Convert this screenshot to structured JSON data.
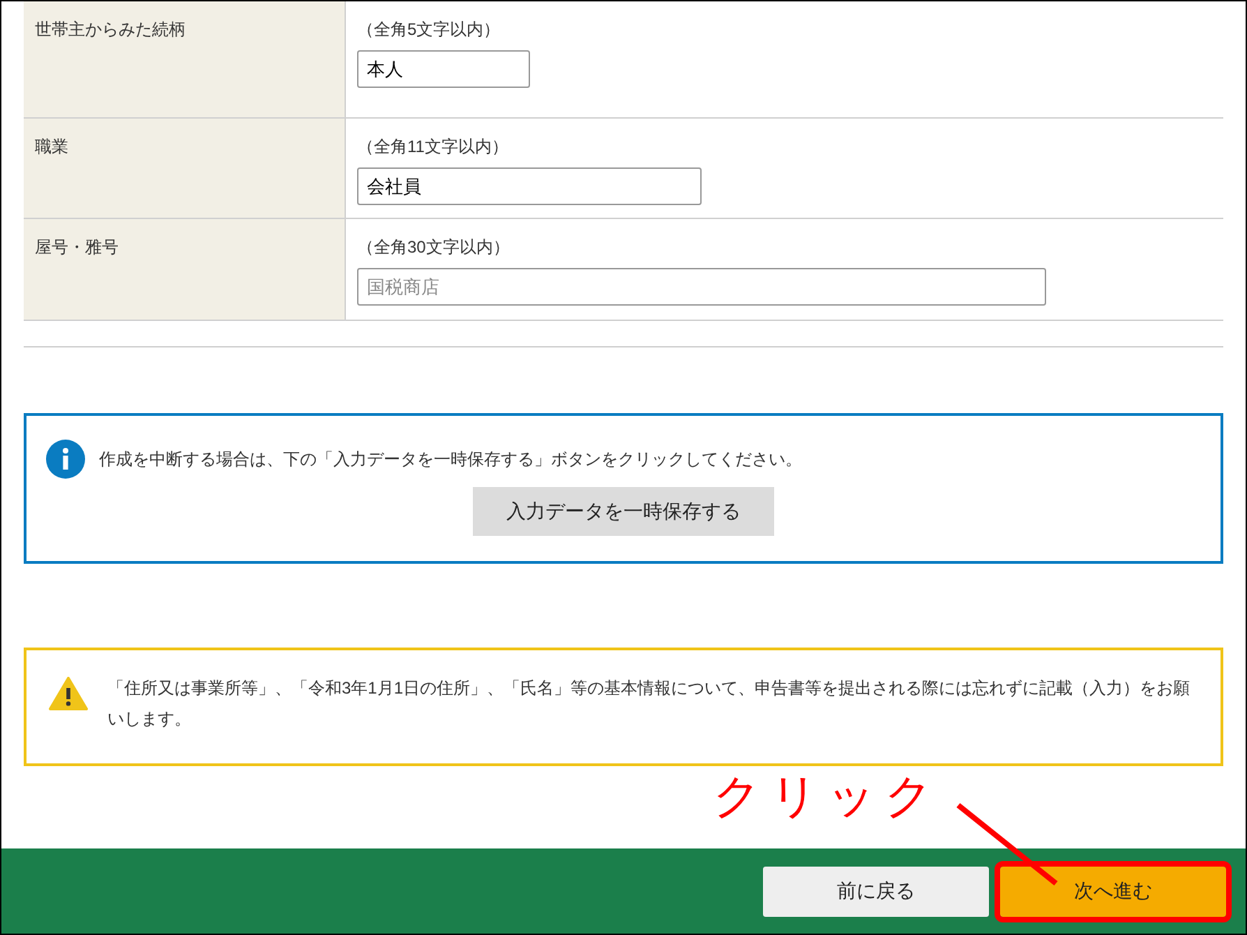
{
  "form_rows": [
    {
      "label": "世帯主からみた続柄",
      "hint": "（全角5文字以内）",
      "value": "本人"
    },
    {
      "label": "職業",
      "hint": "（全角11文字以内）",
      "value": "会社員"
    },
    {
      "label": "屋号・雅号",
      "hint": "（全角30文字以内）",
      "placeholder": "国税商店"
    }
  ],
  "info_notice": {
    "text": "作成を中断する場合は、下の「入力データを一時保存する」ボタンをクリックしてください。",
    "button": "入力データを一時保存する"
  },
  "warning_notice": {
    "text": "「住所又は事業所等」、「令和3年1月1日の住所」、「氏名」等の基本情報について、申告書等を提出される際には忘れずに記載（入力）をお願いします。"
  },
  "annotation": {
    "text": "クリック"
  },
  "footer_buttons": [
    {
      "label": "前に戻る",
      "kind": "back",
      "highlighted": false
    },
    {
      "label": "次へ進む",
      "kind": "next",
      "highlighted": true
    }
  ]
}
